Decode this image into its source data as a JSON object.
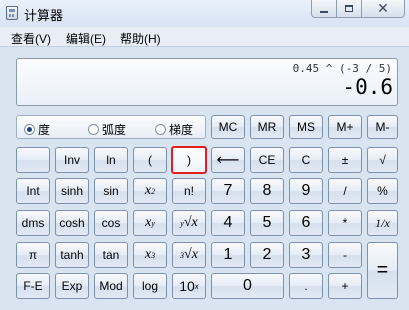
{
  "window": {
    "title": "计算器"
  },
  "menu": {
    "view": "查看(V)",
    "edit": "编辑(E)",
    "help": "帮助(H)"
  },
  "display": {
    "expression": "0.45 ^ (-3 / 5)",
    "result": "-0.6"
  },
  "angle": {
    "degree": "度",
    "radian": "弧度",
    "grad": "梯度",
    "selected": "degree"
  },
  "memory": {
    "mc": "MC",
    "mr": "MR",
    "ms": "MS",
    "mplus": "M+",
    "mminus": "M-"
  },
  "keys": {
    "inv": "Inv",
    "ln": "ln",
    "lparen": "(",
    "rparen": ")",
    "backspace": "⟵",
    "ce": "CE",
    "c": "C",
    "negate": "±",
    "sqrt": "√",
    "int": "Int",
    "sinh": "sinh",
    "sin": "sin",
    "n_fact": "n!",
    "k7": "7",
    "k8": "8",
    "k9": "9",
    "div": "/",
    "percent": "%",
    "dms": "dms",
    "cosh": "cosh",
    "cos": "cos",
    "k4": "4",
    "k5": "5",
    "k6": "6",
    "mul": "*",
    "recip": "1/x",
    "pi": "π",
    "tanh": "tanh",
    "tan": "tan",
    "k1": "1",
    "k2": "2",
    "k3": "3",
    "minus": "-",
    "equals": "=",
    "fe": "F-E",
    "exp": "Exp",
    "mod": "Mod",
    "log": "log",
    "k0": "0",
    "dot": ".",
    "plus": "+"
  }
}
